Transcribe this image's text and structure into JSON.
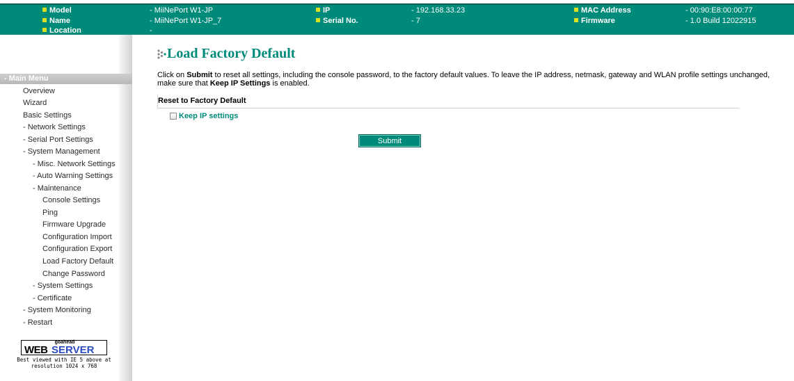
{
  "header": {
    "model_label": "Model",
    "model_value": "- MiiNePort W1-JP",
    "name_label": "Name",
    "name_value": "- MiiNePort W1-JP_7",
    "location_label": "Location",
    "location_value": "-",
    "ip_label": "IP",
    "ip_value": "- 192.168.33.23",
    "serial_label": "Serial No.",
    "serial_value": "- 7",
    "mac_label": "MAC Address",
    "mac_value": "- 00:90:E8:00:00:77",
    "firmware_label": "Firmware",
    "firmware_value": "- 1.0 Build 12022915"
  },
  "sidebar": {
    "heading": "- Main Menu",
    "items": [
      "Overview",
      "Wizard",
      "Basic Settings",
      "- Network Settings",
      "- Serial Port Settings",
      "- System Management",
      "- Misc. Network Settings",
      "- Auto Warning Settings",
      "- Maintenance",
      "Console Settings",
      "Ping",
      "Firmware Upgrade",
      "Configuration Import",
      "Configuration Export",
      "Load Factory Default",
      "Change Password",
      "- System Settings",
      "- Certificate",
      "- System Monitoring",
      "- Restart"
    ],
    "logo": {
      "small": "goahead",
      "web": "WEB",
      "server": "SERVER",
      "note_line1": "Best viewed with IE 5 above at",
      "note_line2": "resolution 1024 x 768"
    }
  },
  "main": {
    "title": "Load Factory Default",
    "desc_pre": "Click on ",
    "desc_submit": "Submit",
    "desc_mid": " to reset all settings, including the console password, to the factory default values. To leave the IP address, netmask, gateway and WLAN profile settings unchanged, make sure that ",
    "desc_keep": "Keep IP Settings",
    "desc_post": " is enabled.",
    "section_title": "Reset to Factory Default",
    "checkbox_label": "Keep IP settings",
    "checkbox_checked": false,
    "submit_label": "Submit"
  },
  "colors": {
    "brand": "#008a79",
    "bullet": "#d9e021",
    "menu_heading": "#c4c4c4"
  }
}
